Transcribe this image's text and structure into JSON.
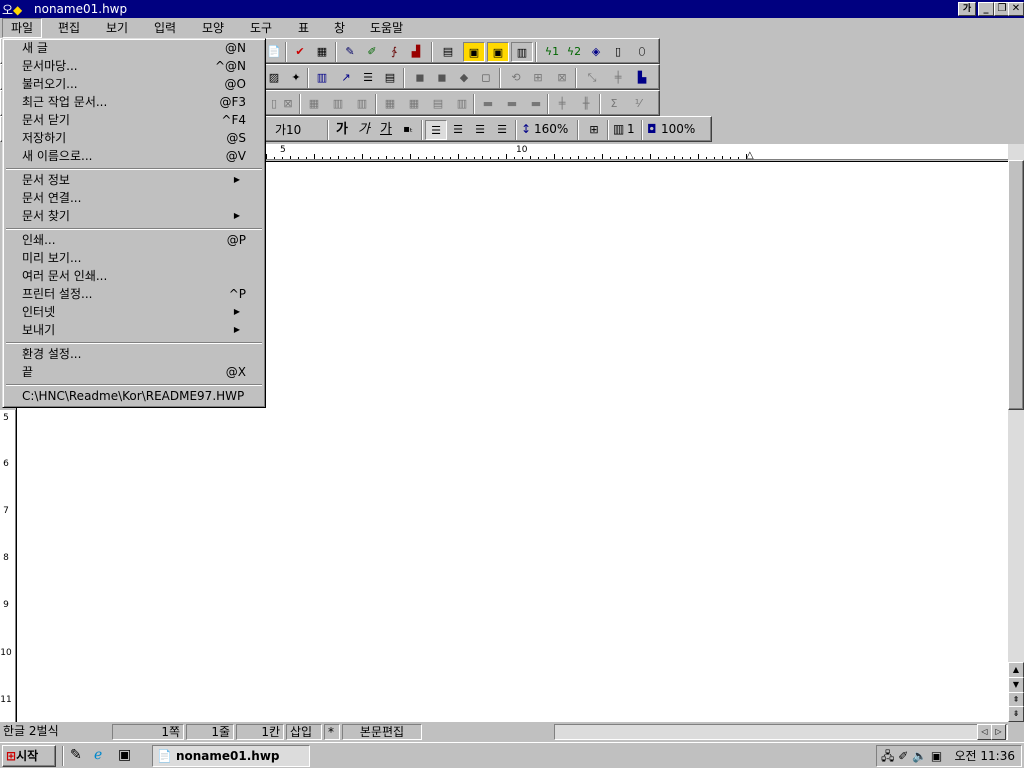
{
  "window": {
    "title": "noname01.hwp",
    "app_icon_text": "오"
  },
  "menubar": [
    "파일",
    "편집",
    "보기",
    "입력",
    "모양",
    "도구",
    "표",
    "창",
    "도움말"
  ],
  "file_menu": {
    "group1": [
      {
        "label": "새 글",
        "shortcut": "@N"
      },
      {
        "label": "문서마당...",
        "shortcut": "^@N"
      },
      {
        "label": "불러오기...",
        "shortcut": "@O"
      },
      {
        "label": "최근 작업 문서...",
        "shortcut": "@F3"
      },
      {
        "label": "문서 닫기",
        "shortcut": "^F4"
      },
      {
        "label": "저장하기",
        "shortcut": "@S"
      },
      {
        "label": "새 이름으로...",
        "shortcut": "@V"
      }
    ],
    "group2": [
      {
        "label": "문서 정보"
      },
      {
        "label": "문서 연결..."
      },
      {
        "label": "문서 찾기"
      }
    ],
    "group3": [
      {
        "label": "인쇄...",
        "shortcut": "@P"
      },
      {
        "label": "미리 보기..."
      },
      {
        "label": "여러 문서 인쇄..."
      },
      {
        "label": "프린터 설정...",
        "shortcut": "^P"
      },
      {
        "label": "인터넷"
      },
      {
        "label": "보내기"
      }
    ],
    "group4": [
      {
        "label": "환경 설정..."
      },
      {
        "label": "끝",
        "shortcut": "@X"
      }
    ],
    "recent": "C:\\HNC\\Readme\\Kor\\README97.HWP"
  },
  "format_toolbar": {
    "font_size": "가10",
    "bold": "가",
    "italic": "가",
    "underline": "가",
    "line_spacing": "160%",
    "columns": "1",
    "zoom": "100%"
  },
  "ruler": {
    "marks": [
      "5",
      "10"
    ]
  },
  "vruler": {
    "marks": [
      "5",
      "6",
      "7",
      "8",
      "9",
      "10",
      "11"
    ]
  },
  "status": {
    "ime": "한글 2벌식",
    "page": "1쪽",
    "line": "1줄",
    "column": "1칸",
    "insert": "삽입",
    "mark": "*",
    "mode": "본문편집"
  },
  "taskbar": {
    "start": "시작",
    "task": "noname01.hwp",
    "clock": "오전 11:36"
  }
}
